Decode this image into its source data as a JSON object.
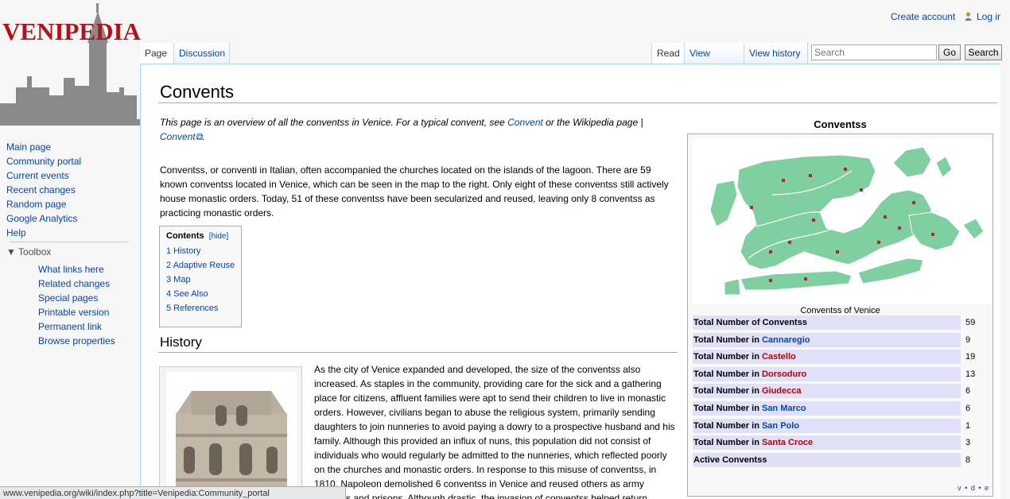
{
  "site": {
    "logo_text": "VENIPEDIA"
  },
  "personal": {
    "create_account": "Create account",
    "login": "Log ir"
  },
  "tabs": {
    "page": "Page",
    "discussion": "Discussion",
    "read": "Read",
    "view_source": "View source",
    "view_history": "View history"
  },
  "search": {
    "placeholder": "Search",
    "go": "Go",
    "search_btn": "Search"
  },
  "sidebar": {
    "nav": [
      "Main page",
      "Community portal",
      "Current events",
      "Recent changes",
      "Random page",
      "Google Analytics",
      "Help"
    ],
    "toolbox_label": "Toolbox",
    "tools": [
      "What links here",
      "Related changes",
      "Special pages",
      "Printable version",
      "Permanent link",
      "Browse properties"
    ]
  },
  "article": {
    "title": "Convents",
    "hatnote_1": "This page is an overview of all the conventss in Venice. For a typical convent, see ",
    "hatnote_link1": "Convent",
    "hatnote_2": " or the Wikipedia page | ",
    "hatnote_link2": "Convent",
    "intro": "Conventss, or conventi in Italian, often accompanied the churches located on the islands of the lagoon. There are 59 known conventss located in Venice, which can be seen in the map to the right. Only eight of these conventss still actively house monastic orders. Today, 51 of these conventss have been secularized and reused, leaving only 8 conventss as practicing monastic orders.",
    "toc": {
      "title": "Contents",
      "hide": "[hide]",
      "items": [
        "1 History",
        "2 Adaptive Reuse",
        "3 Map",
        "4 See Also",
        "5 References"
      ]
    },
    "history_heading": "History",
    "history_text": "As the city of Venice expanded and developed, the size of the conventss also increased. As staples in the community, providing care for the sick and a gathering place for citizens, affluent families were apt to send their children to live in monastic orders. However, civilians began to abuse the religious system, primarily sending daughters to join nunneries to avoid paying a dowry to a prospective husband and his family. Although this provided an influx of nuns, this population did not consist of individuals who would regularly be admitted to the nunneries, which reflected poorly on the churches and monastic orders. In response to this misuse of conventss, in 1810, Napoleon demolished 6 conventss in Venice and reused others as army barracks and prisons. Although drastic, the invasion of conventss helped return"
  },
  "infobox": {
    "title": "Conventss",
    "caption": "Conventss of Venice",
    "rows": [
      {
        "prefix": "Total Number of Conventss",
        "link": "",
        "color": "",
        "value": "59"
      },
      {
        "prefix": "Total Number in ",
        "link": "Cannaregio",
        "color": "blue",
        "value": "9"
      },
      {
        "prefix": "Total Number in ",
        "link": "Castello",
        "color": "red",
        "value": "19"
      },
      {
        "prefix": "Total Number in ",
        "link": "Dorsoduro",
        "color": "red",
        "value": "13"
      },
      {
        "prefix": "Total Number in ",
        "link": "Giudecca",
        "color": "red",
        "value": "6"
      },
      {
        "prefix": "Total Number in ",
        "link": "San Marco",
        "color": "blue",
        "value": "6"
      },
      {
        "prefix": "Total Number in ",
        "link": "San Polo",
        "color": "blue",
        "value": "1"
      },
      {
        "prefix": "Total Number in ",
        "link": "Santa Croce",
        "color": "red",
        "value": "3"
      },
      {
        "prefix": "Active Conventss",
        "link": "",
        "color": "",
        "value": "8"
      }
    ],
    "vde": "v • d • e"
  },
  "statusbar": {
    "url": "www.venipedia.org/wiki/index.php?title=Venipedia:Community_portal"
  },
  "colors": {
    "link": "#0645ad",
    "redlink": "#ba0000",
    "map_land": "#7fcfa0",
    "logo": "#b0141a"
  }
}
